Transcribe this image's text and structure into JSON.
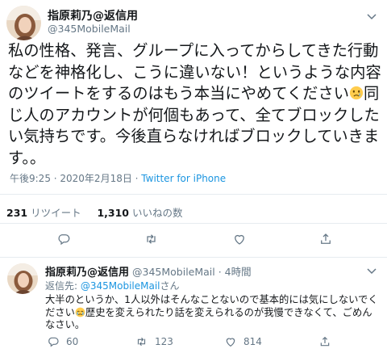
{
  "tweet": {
    "display_name": "指原莉乃@返信用",
    "handle": "@345MobileMail",
    "body_lines": [
      "私の性格、発言、グループに入ってからしてきた行動",
      "などを神格化し、こうに違いない！というような内容",
      "のツイートをするのはもう本当にやめてください",
      "同",
      "じ人のアカウントが何個もあって、全てブロックした",
      "い気持ちです。今後直らなければブロックしていきま",
      "す。。"
    ],
    "time": "午後9:25 · 2020年2月18日 · ",
    "source": "Twitter for iPhone",
    "retweets_count": "231",
    "retweets_label": "リツイート",
    "likes_count": "1,310",
    "likes_label": "いいねの数",
    "icons": [
      "caret-down-icon",
      "reply-icon",
      "retweet-icon",
      "like-icon",
      "share-icon",
      "crying-face-emoji"
    ]
  },
  "reply": {
    "display_name": "指原莉乃@返信用",
    "handle_time": "@345MobileMail · 4時間",
    "replying_prefix": "返信先: ",
    "replying_mention": "@345MobileMail",
    "replying_suffix": "さん",
    "text_lines": [
      "大半のというか、1人以外はそんなことないので基本的には気にしないでく",
      "ださい",
      "歴史を変えられたり話を変えられるのが我慢できなくて、ごめん",
      "なさい。"
    ],
    "reply_count": "60",
    "retweet_count": "123",
    "like_count": "814"
  },
  "colors": {
    "secondary_text": "#657786",
    "link": "#1b95e0",
    "divider": "#e6ecf0"
  }
}
